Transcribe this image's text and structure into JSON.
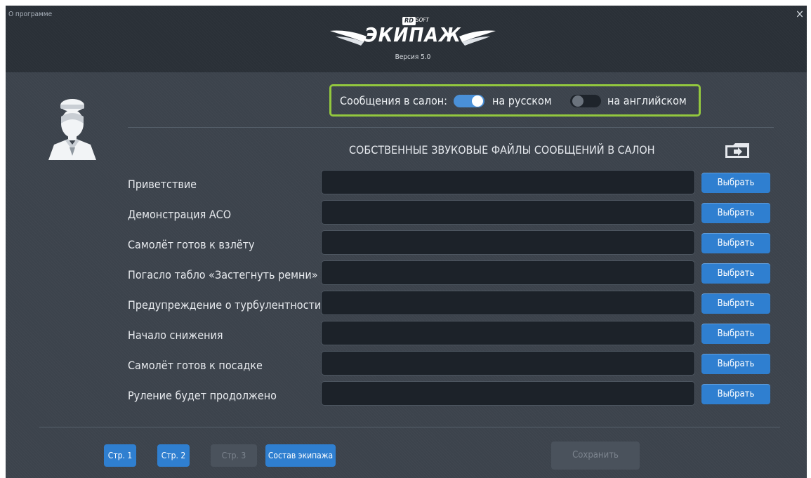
{
  "window": {
    "about_label": "О программе",
    "close_glyph": "×"
  },
  "logo": {
    "brand_rd": "RD",
    "brand_soft": "SOFT",
    "title": "ЭКИПАЖ",
    "version": "Версия 5.0"
  },
  "cabin_messages": {
    "label": "Сообщения в салон:",
    "options": [
      {
        "label": "на русском",
        "enabled": true
      },
      {
        "label": "на английском",
        "enabled": false
      }
    ]
  },
  "sound_files": {
    "title": "СОБСТВЕННЫЕ ЗВУКОВЫЕ ФАЙЛЫ СООБЩЕНИЙ В САЛОН",
    "choose_label": "Выбрать",
    "rows": [
      {
        "label": "Приветствие",
        "value": ""
      },
      {
        "label": "Демонстрация АСО",
        "value": ""
      },
      {
        "label": "Самолёт готов к взлёту",
        "value": ""
      },
      {
        "label": "Погасло табло «Застегнуть ремни»",
        "value": ""
      },
      {
        "label": "Предупреждение о турбулентности",
        "value": ""
      },
      {
        "label": "Начало снижения",
        "value": ""
      },
      {
        "label": "Самолёт готов к посадке",
        "value": ""
      },
      {
        "label": "Руление будет продолжено",
        "value": ""
      }
    ]
  },
  "footer": {
    "pages": [
      {
        "label": "Стр. 1",
        "enabled": true
      },
      {
        "label": "Стр. 2",
        "enabled": true
      },
      {
        "label": "Стр. 3",
        "enabled": false
      }
    ],
    "crew_label": "Состав экипажа",
    "save_label": "Сохранить"
  },
  "colors": {
    "accent_blue": "#2f7fd0",
    "highlight_green": "#93c83e",
    "background": "#3c434c"
  }
}
